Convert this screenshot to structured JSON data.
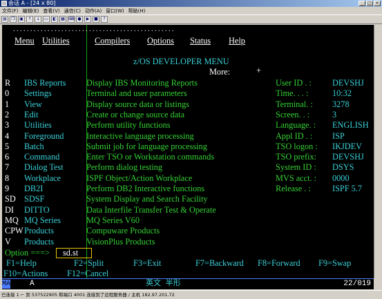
{
  "window": {
    "title": "会话 A - [24 x 80]",
    "buttons": [
      "_",
      "□",
      "×"
    ]
  },
  "menubar": [
    "文件(F)",
    "编辑(E)",
    "查看(V)",
    "通信(C)",
    "动作(A)",
    "窗口(W)",
    "帮助(H)"
  ],
  "toolbar_icons": [
    "print-icon",
    "copy-icon",
    "paste-icon",
    "send-icon",
    "receive-icon",
    "display-icon",
    "color-icon",
    "map-icon",
    "keyboard-icon",
    "macro-record-icon",
    "macro-play-icon",
    "stop-icon",
    "help-icon"
  ],
  "screen": {
    "dots": ". . . . . . . . . . . . . . . . . . . . . . . . . . . . . . . . . . . . . . . . . . . . . . .",
    "menu": [
      "Menu",
      "Utilities",
      "Compilers",
      "Options",
      "Status",
      "Help"
    ],
    "panel_title": "z/OS DEVELOPER MENU",
    "more_label": "More:",
    "more_indicator": "+",
    "options": [
      {
        "key": "R",
        "name": "IBS Reports",
        "desc": "Display IBS Monitoring Reports"
      },
      {
        "key": "0",
        "name": "Settings",
        "desc": "Terminal and user parameters"
      },
      {
        "key": "1",
        "name": "View",
        "desc": "Display source data or listings"
      },
      {
        "key": "2",
        "name": "Edit",
        "desc": "Create or change source data"
      },
      {
        "key": "3",
        "name": "Utilities",
        "desc": "Perform utility functions"
      },
      {
        "key": "4",
        "name": "Foreground",
        "desc": "Interactive language processing"
      },
      {
        "key": "5",
        "name": "Batch",
        "desc": "Submit job for language processing"
      },
      {
        "key": "6",
        "name": "Command",
        "desc": "Enter TSO or Workstation commands"
      },
      {
        "key": "7",
        "name": "Dialog Test",
        "desc": "Perform dialog testing"
      },
      {
        "key": "8",
        "name": "Workplace",
        "desc": "ISPF Object/Action Workplace"
      },
      {
        "key": "9",
        "name": "DB2I",
        "desc": "Perform DB2 Interactive functions"
      },
      {
        "key": "SD",
        "name": "SDSF",
        "desc": "System Display and Search Facility"
      },
      {
        "key": "DI",
        "name": "DITTO",
        "desc": "Data Interfile Transfer Test & Operate"
      },
      {
        "key": "MQ",
        "name": "MQ Series",
        "desc": "MQ Series V60"
      },
      {
        "key": "CPW",
        "name": "Products",
        "desc": "Compuware Products"
      },
      {
        "key": "V",
        "name": "Products",
        "desc": "VisionPlus Products"
      }
    ],
    "info": [
      {
        "label": "User ID . :",
        "value": "DEVSHJ"
      },
      {
        "label": "Time. . . :",
        "value": "10:32"
      },
      {
        "label": "Terminal. :",
        "value": "3278"
      },
      {
        "label": "Screen. . :",
        "value": "3"
      },
      {
        "label": "Language. :",
        "value": "ENGLISH"
      },
      {
        "label": "Appl ID . :",
        "value": "ISP"
      },
      {
        "label": "TSO logon :",
        "value": "IKJDEV"
      },
      {
        "label": "TSO prefix:",
        "value": "DEVSHJ"
      },
      {
        "label": "System ID :",
        "value": "DSYS"
      },
      {
        "label": "MVS acct. :",
        "value": "0000"
      },
      {
        "label": "Release . :",
        "value": "ISPF 5.7"
      }
    ],
    "option_prompt": "Option ===>",
    "option_value": "sd.st",
    "pf_row1": [
      {
        "key": "F1",
        "label": "Help"
      },
      {
        "key": "F2",
        "label": "Split"
      },
      {
        "key": "F3",
        "label": "Exit"
      },
      {
        "key": "F7",
        "label": "Backward"
      },
      {
        "key": "F8",
        "label": "Forward"
      },
      {
        "key": "F9",
        "label": "Swap"
      }
    ],
    "pf_row2": [
      {
        "key": "F10",
        "label": "Actions"
      },
      {
        "key": "F12",
        "label": "Cancel"
      }
    ]
  },
  "oia": {
    "ma": "MA",
    "session": "A",
    "ime": "英文 半形",
    "cursor_pos": "22/019"
  },
  "statusbar": {
    "text": "已连接 1 ⌐ 到 537522905 和端口 4001 连接到了远程服务器 / 主机 182.97.201.72"
  },
  "colors": {
    "white": "#ffffff",
    "cyan": "#3ad1d8",
    "green": "#35d235",
    "yellow": "#e0e000",
    "blue": "#4a7bff"
  }
}
